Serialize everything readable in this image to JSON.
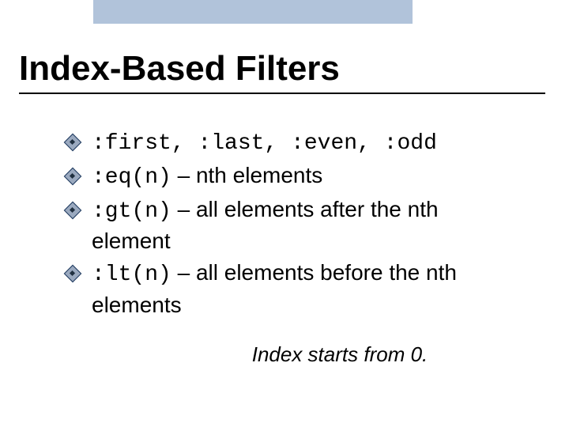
{
  "title": "Index-Based Filters",
  "filters": [
    {
      "code": ":first, :last, :even, :odd",
      "desc": ""
    },
    {
      "code": ":eq(n)",
      "desc": " – nth elements"
    },
    {
      "code": ":gt(n)",
      "desc": " – all elements after the nth element"
    },
    {
      "code": ":lt(n)",
      "desc": " – all elements before the nth elements"
    }
  ],
  "note": "Index starts from 0."
}
